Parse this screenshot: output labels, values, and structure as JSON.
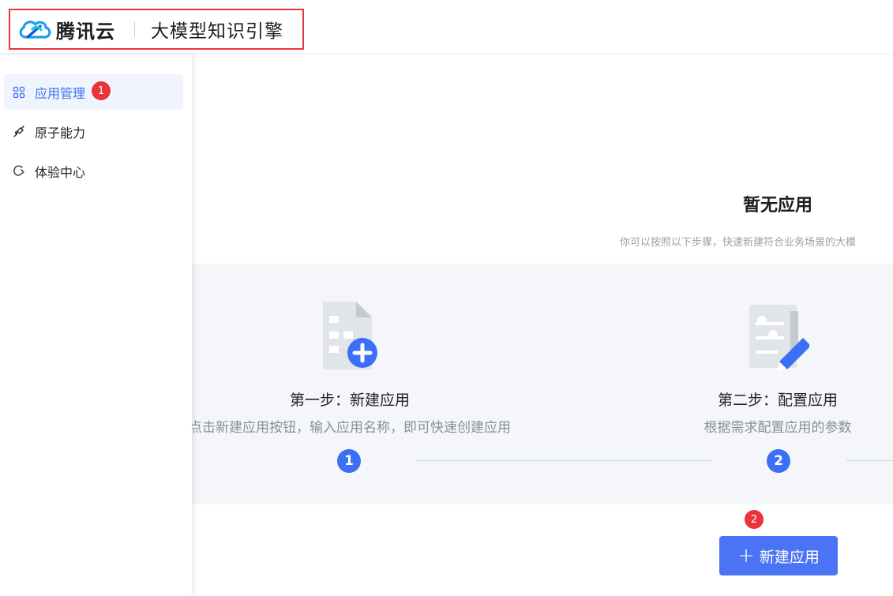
{
  "header": {
    "brand_name": "腾讯云",
    "product_name": "大模型知识引擎"
  },
  "sidebar": {
    "items": [
      {
        "label": "应用管理",
        "icon": "grid-icon",
        "active": true,
        "badge": "1"
      },
      {
        "label": "原子能力",
        "icon": "atom-icon",
        "active": false
      },
      {
        "label": "体验中心",
        "icon": "experience-icon",
        "active": false
      }
    ]
  },
  "main": {
    "empty_title": "暂无应用",
    "empty_desc": "你可以按照以下步骤，快速新建符合业务场景的大模",
    "steps": [
      {
        "number": "1",
        "title": "第一步：新建应用",
        "desc": "点击新建应用按钮，输入应用名称，即可快速创建应用",
        "icon": "new-document-icon"
      },
      {
        "number": "2",
        "title": "第二步：配置应用",
        "desc": "根据需求配置应用的参数",
        "icon": "config-edit-icon"
      }
    ],
    "new_button_label": "新建应用",
    "new_button_badge": "2"
  },
  "colors": {
    "accent": "#3b6ff5",
    "button": "#4a74f5",
    "badge": "#e8343a",
    "highlight_border": "#e5393b",
    "panel_bg": "#f4f6f9"
  }
}
